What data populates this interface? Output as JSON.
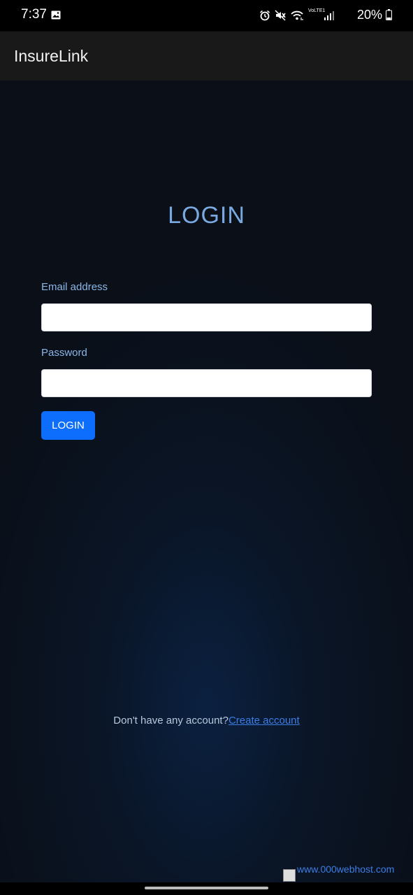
{
  "status_bar": {
    "time": "7:37",
    "battery_percent": "20%",
    "icons": [
      "gallery-icon",
      "alarm-icon",
      "mute-icon",
      "wifi-icon",
      "volte-icon",
      "signal-icon",
      "battery-icon"
    ],
    "volte_label": "VoLTE1"
  },
  "app_bar": {
    "title": "InsureLink"
  },
  "login": {
    "heading": "LOGIN",
    "email_label": "Email address",
    "email_value": "",
    "password_label": "Password",
    "password_value": "",
    "button_label": "LOGIN"
  },
  "signup": {
    "prompt": "Don't have any account?",
    "link_label": "Create account"
  },
  "host_badge": {
    "text": "www.000webhost.com"
  },
  "colors": {
    "accent": "#0d6efd",
    "heading": "#79a9e0",
    "label": "#8ab7e8",
    "link": "#3d7de6",
    "background": "#0a1526",
    "app_bar": "#191919"
  }
}
